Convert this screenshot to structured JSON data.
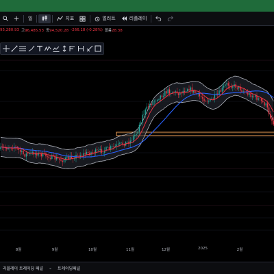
{
  "toolbar": {
    "interval_label": "일",
    "indicators_label": "지표",
    "alert_label": "얼러트",
    "replay_label": "리플레이"
  },
  "ohlc": {
    "open_value": "95,280.93",
    "high_label": "고",
    "high_value": "96,485.53",
    "close_label": "종",
    "close_value": "94,520.28",
    "change_text": "-266.18 (-0.28%)",
    "volume_label": "볼륨",
    "volume_value": "28.38"
  },
  "drawing_tools": [
    "crosshair-icon",
    "trendline-icon",
    "fib-icon",
    "brush-icon",
    "text-icon",
    "pattern-icon",
    "prediction-icon",
    "measure-icon",
    "emoji-icon",
    "position-icon",
    "ruler-icon",
    "zoom-icon"
  ],
  "time_axis": {
    "ticks": [
      "8월",
      "9월",
      "10월",
      "11월",
      "12월",
      "2025",
      "2월"
    ]
  },
  "bottom_bar": {
    "tab1": "리플레이 트레이딩 패널",
    "tab2": "트레이딩패널"
  },
  "colors": {
    "up": "#26a69a",
    "down": "#f23645",
    "sma": "#2962ff",
    "ema": "#f23645",
    "band_fill": "#2a2e39",
    "topbar": "#1f6b3a",
    "highlight_zone": "#f0a057"
  }
}
